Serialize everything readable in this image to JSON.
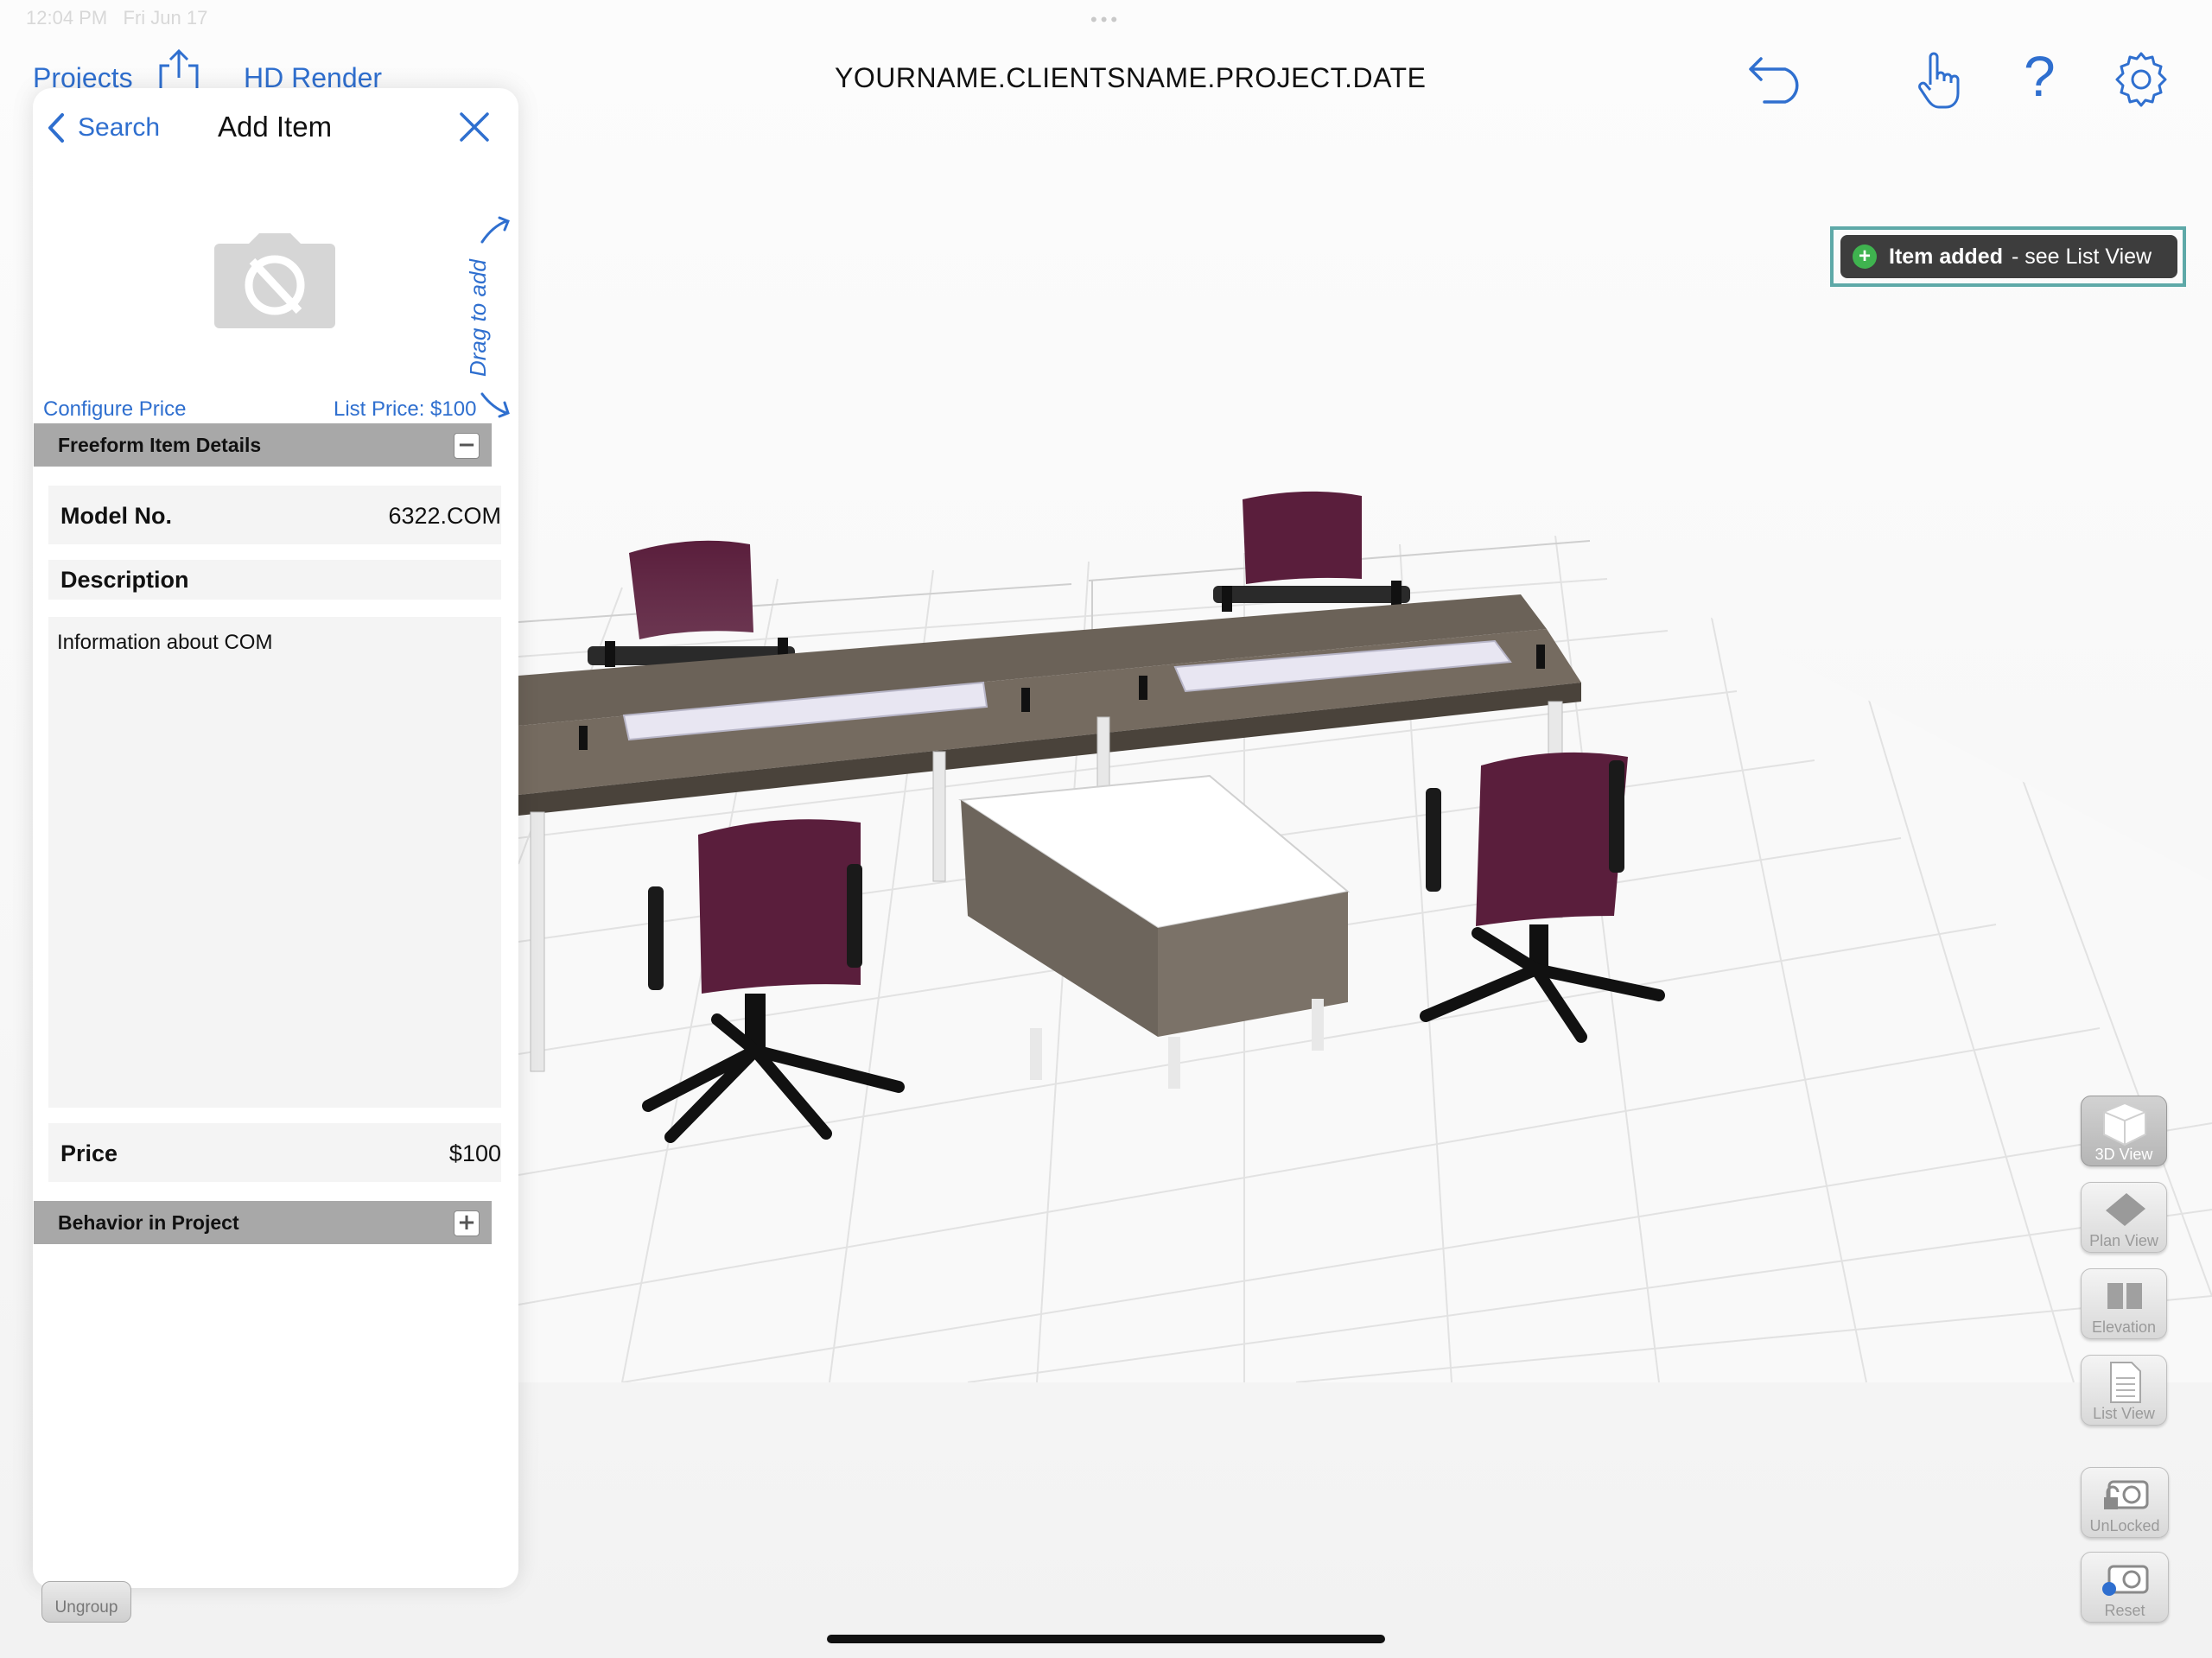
{
  "status_bar": {
    "time": "12:04 PM",
    "date": "Fri Jun 17"
  },
  "topbar": {
    "projects_label": "Projects",
    "hd_render_label": "HD Render",
    "project_title": "YOURNAME.CLIENTSNAME.PROJECT.DATE",
    "icons": [
      "share-icon",
      "undo-icon",
      "hand-pointer-icon",
      "help-icon",
      "gear-icon"
    ],
    "help_glyph": "?"
  },
  "toast": {
    "bold": "Item added",
    "rest": "- see List View",
    "color": "#3d3d3d",
    "accent": "#3fb34f"
  },
  "panel": {
    "back_label": "Search",
    "title": "Add Item",
    "drag_hint": "Drag to add",
    "configure_price": "Configure Price",
    "list_price": "List Price: $100",
    "section_details": "Freeform Item Details",
    "details_toggle": "−",
    "model_label": "Model No.",
    "model_value": "6322.COM",
    "description_label": "Description",
    "description_text": "Information about COM",
    "price_label": "Price",
    "price_value": "$100",
    "section_behavior": "Behavior in Project",
    "behavior_toggle": "+"
  },
  "tools": {
    "view_3d": "3D View",
    "plan_view": "Plan View",
    "elevation": "Elevation",
    "list_view": "List View",
    "unlocked": "UnLocked",
    "reset": "Reset",
    "active": "3D View"
  },
  "ungroup_label": "Ungroup",
  "colors": {
    "accent": "#2f6fcf",
    "chair": "#5a1e3c",
    "desk_top": "#6b6258",
    "toast_border": "#5ea9a8"
  }
}
